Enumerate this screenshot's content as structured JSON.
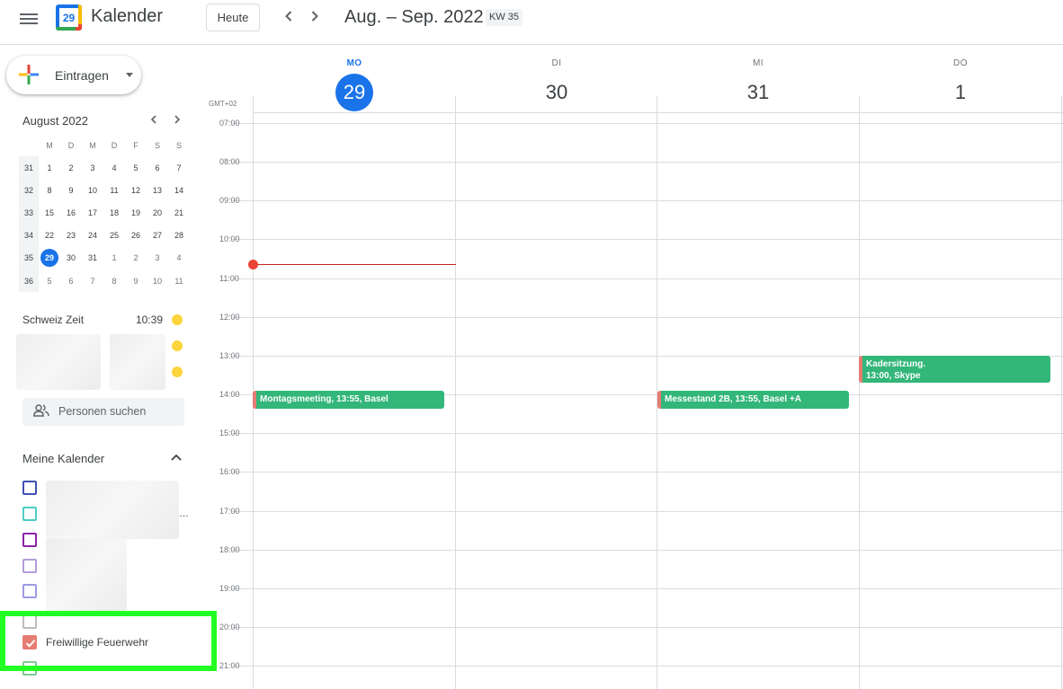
{
  "header": {
    "app_title": "Kalender",
    "logo_text": "29",
    "today_label": "Heute",
    "prev_icon": "chevron-left-icon",
    "next_icon": "chevron-right-icon",
    "date_range": "Aug. – Sep. 2022",
    "week_badge": "KW 35"
  },
  "sidebar": {
    "create_label": "Eintragen",
    "mini_calendar": {
      "title": "August 2022",
      "weekday_headers": [
        "M",
        "D",
        "M",
        "D",
        "F",
        "S",
        "S"
      ],
      "weeks": [
        {
          "wk": "31",
          "days": [
            "1",
            "2",
            "3",
            "4",
            "5",
            "6",
            "7"
          ]
        },
        {
          "wk": "32",
          "days": [
            "8",
            "9",
            "10",
            "11",
            "12",
            "13",
            "14"
          ]
        },
        {
          "wk": "33",
          "days": [
            "15",
            "16",
            "17",
            "18",
            "19",
            "20",
            "21"
          ]
        },
        {
          "wk": "34",
          "days": [
            "22",
            "23",
            "24",
            "25",
            "26",
            "27",
            "28"
          ]
        },
        {
          "wk": "35",
          "days": [
            "29",
            "30",
            "31",
            "1",
            "2",
            "3",
            "4"
          ]
        },
        {
          "wk": "36",
          "days": [
            "5",
            "6",
            "7",
            "8",
            "9",
            "10",
            "11"
          ]
        }
      ],
      "today": "29"
    },
    "world_clock": {
      "label": "Schweiz Zeit",
      "time": "10:39"
    },
    "people_search_placeholder": "Personen suchen",
    "my_calendars": {
      "title": "Meine Kalender",
      "items": [
        {
          "label": "",
          "color": "#3f51b5",
          "checked": false
        },
        {
          "label": "",
          "color": "#4ecdc4",
          "checked": false
        },
        {
          "label": "",
          "color": "#8e24aa",
          "checked": false
        },
        {
          "label": "",
          "color": "#b39ddb",
          "checked": false
        },
        {
          "label": "",
          "color": "#9e9ae0",
          "checked": false
        },
        {
          "label": "Freiwillige Feuerwehr",
          "color": "#e67c73",
          "checked": true
        }
      ]
    }
  },
  "grid": {
    "timezone": "GMT+02",
    "days": [
      {
        "dow": "MO",
        "num": "29",
        "today": true
      },
      {
        "dow": "DI",
        "num": "30",
        "today": false
      },
      {
        "dow": "MI",
        "num": "31",
        "today": false
      },
      {
        "dow": "DO",
        "num": "1",
        "today": false
      }
    ],
    "hours": [
      "07:00",
      "08:00",
      "09:00",
      "10:00",
      "11:00",
      "12:00",
      "13:00",
      "14:00",
      "15:00",
      "16:00",
      "17:00",
      "18:00",
      "19:00",
      "20:00",
      "21:00"
    ],
    "events": [
      {
        "title": "Montagsmeeting, 13:55, Basel"
      },
      {
        "title": "Messestand 2B, 13:55, Basel +A"
      },
      {
        "title": "Kadersitzung.",
        "subtitle": "13:00, Skype"
      }
    ],
    "event_color": "#33b679",
    "now_color": "#ea4335"
  }
}
